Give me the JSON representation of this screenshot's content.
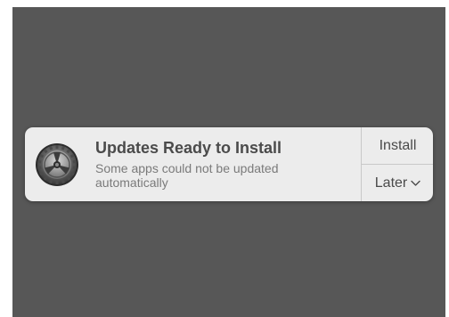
{
  "notification": {
    "app_icon": "system-preferences-gear-icon",
    "title": "Updates Ready to Install",
    "body_line1": "Some apps could not be updated",
    "body_line2": "automatically",
    "actions": {
      "install_label": "Install",
      "later_label": "Later",
      "later_icon": "chevron-down-icon"
    }
  },
  "colors": {
    "desktop": "#575757",
    "banner": "#ececec",
    "title_text": "#4b4b4b",
    "body_text": "#7a7a7a",
    "divider": "#c9c9c9"
  }
}
